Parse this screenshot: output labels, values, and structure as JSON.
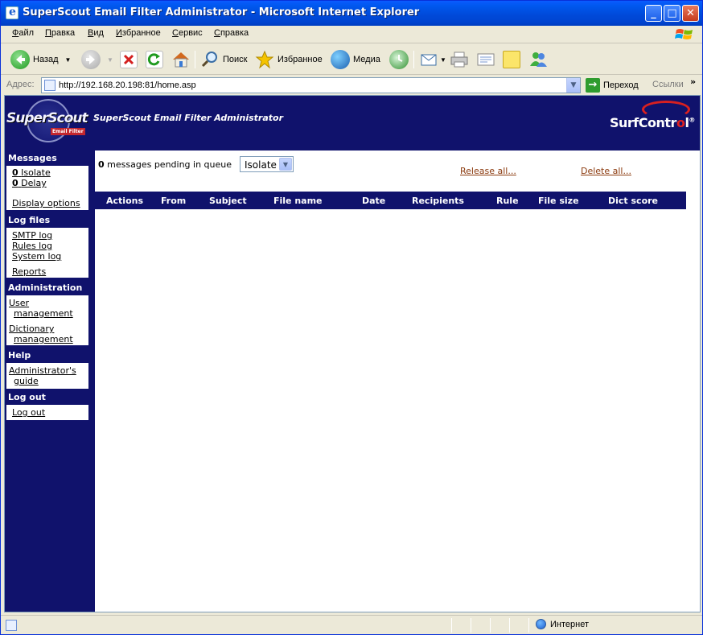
{
  "window": {
    "title": "SuperScout Email Filter Administrator - Microsoft Internet Explorer"
  },
  "menu": {
    "items": [
      "Файл",
      "Правка",
      "Вид",
      "Избранное",
      "Сервис",
      "Справка"
    ]
  },
  "toolbar": {
    "back": "Назад",
    "search": "Поиск",
    "favorites": "Избранное",
    "media": "Медиа"
  },
  "address": {
    "label": "Адрес:",
    "url": "http://192.168.20.198:81/home.asp",
    "go": "Переход",
    "links": "Ссылки",
    "chevron": "»"
  },
  "banner": {
    "logo_text": "SuperScout",
    "logo_badge": "Email Filter",
    "title": "SuperScout Email Filter Administrator",
    "brand_main": "SurfContr",
    "brand_accent": "o",
    "brand_tail": "l",
    "brand_mark": "®"
  },
  "sidebar": {
    "messages_head": "Messages",
    "isolate_count": "0",
    "isolate_label": "Isolate",
    "delay_count": "0",
    "delay_label": "Delay",
    "display_options": "Display options",
    "logfiles_head": "Log files",
    "smtp_log": "SMTP log",
    "rules_log": "Rules log",
    "system_log": "System log",
    "reports": "Reports",
    "admin_head": "Administration",
    "user_mgmt_1": "User",
    "user_mgmt_2": "management",
    "dict_mgmt_1": "Dictionary",
    "dict_mgmt_2": "management",
    "help_head": "Help",
    "admin_guide_1": "Administrator's",
    "admin_guide_2": "guide",
    "logout_head": "Log out",
    "logout_link": "Log out"
  },
  "main": {
    "pending_count": "0",
    "pending_text": "messages pending in queue",
    "queue_selected": "Isolate",
    "release_all": "Release all...",
    "delete_all": "Delete all...",
    "columns": [
      "Actions",
      "From",
      "Subject",
      "File name",
      "Date",
      "Recipients",
      "Rule",
      "File size",
      "Dict score"
    ]
  },
  "status": {
    "zone": "Интернет"
  },
  "colors": {
    "navy": "#10126c",
    "link_brown": "#8b3a0e",
    "xp_blue": "#0049D8"
  }
}
